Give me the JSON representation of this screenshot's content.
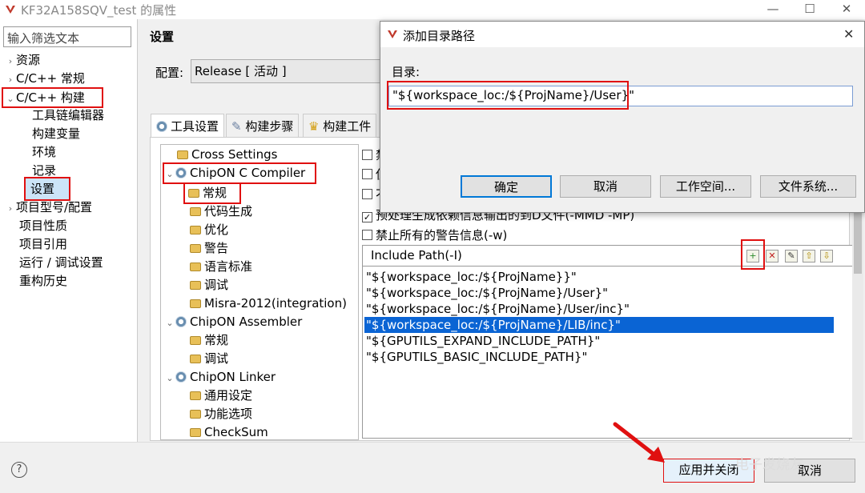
{
  "window": {
    "title": "KF32A158SQV_test 的属性",
    "minimize": "—",
    "maximize": "☐",
    "close": "✕"
  },
  "left": {
    "filter_placeholder": "输入筛选文本",
    "items": [
      {
        "label": "资源",
        "chev": "›"
      },
      {
        "label": "C/C++ 常规",
        "chev": "›"
      },
      {
        "label": "C/C++ 构建",
        "chev": "⌄"
      },
      {
        "label": "工具链编辑器"
      },
      {
        "label": "构建变量"
      },
      {
        "label": "环境"
      },
      {
        "label": "记录"
      },
      {
        "label": "设置"
      },
      {
        "label": "项目型号/配置",
        "chev": "›"
      },
      {
        "label": "项目性质"
      },
      {
        "label": "项目引用"
      },
      {
        "label": "运行 / 调试设置"
      },
      {
        "label": "重构历史"
      }
    ]
  },
  "settings": {
    "title": "设置",
    "config_label": "配置:",
    "config_value": "Release  [ 活动 ]"
  },
  "tabs": [
    "工具设置",
    "构建步骤",
    "构建工件"
  ],
  "tool_tree": {
    "cross": "Cross Settings",
    "compiler": "ChipON C Compiler",
    "compiler_children": [
      "常规",
      "代码生成",
      "优化",
      "警告",
      "语言标准",
      "调试",
      "Misra-2012(integration)"
    ],
    "assembler": "ChipON Assembler",
    "assembler_children": [
      "常规",
      "调试"
    ],
    "linker": "ChipON Linker",
    "linker_children": [
      "通用设定",
      "功能选项",
      "CheckSum"
    ]
  },
  "options": {
    "opt1": "禁",
    "opt2": "使",
    "opt3": "不",
    "opt4": "预处理生成依赖信息输出的到D文件(-MMD -MP)",
    "opt5": "禁止所有的警告信息(-w)",
    "opt4_checked": "✓"
  },
  "include": {
    "header": "Include Path(-I)",
    "toolbar": [
      "+",
      "✕",
      "✎",
      "⇧",
      "⇩"
    ],
    "paths": [
      "\"${workspace_loc:/${ProjName}}\"",
      "\"${workspace_loc:/${ProjName}/User}\"",
      "\"${workspace_loc:/${ProjName}/User/inc}\"",
      "\"${workspace_loc:/${ProjName}/LIB/inc}\"",
      "\"${GPUTILS_EXPAND_INCLUDE_PATH}\"",
      "\"${GPUTILS_BASIC_INCLUDE_PATH}\""
    ],
    "selected_index": 3
  },
  "bottom": {
    "help": "?",
    "apply_close": "应用并关闭",
    "cancel": "取消"
  },
  "dialog": {
    "title": "添加目录路径",
    "close": "✕",
    "dir_label": "目录:",
    "dir_value": "\"${workspace_loc:/${ProjName}/User}\"",
    "ok": "确定",
    "cancel": "取消",
    "workspace": "工作空间...",
    "filesystem": "文件系统..."
  },
  "watermark": "电子发烧友",
  "colors": {
    "accent_red": "#e01010",
    "selection_blue": "#0a64d4"
  }
}
